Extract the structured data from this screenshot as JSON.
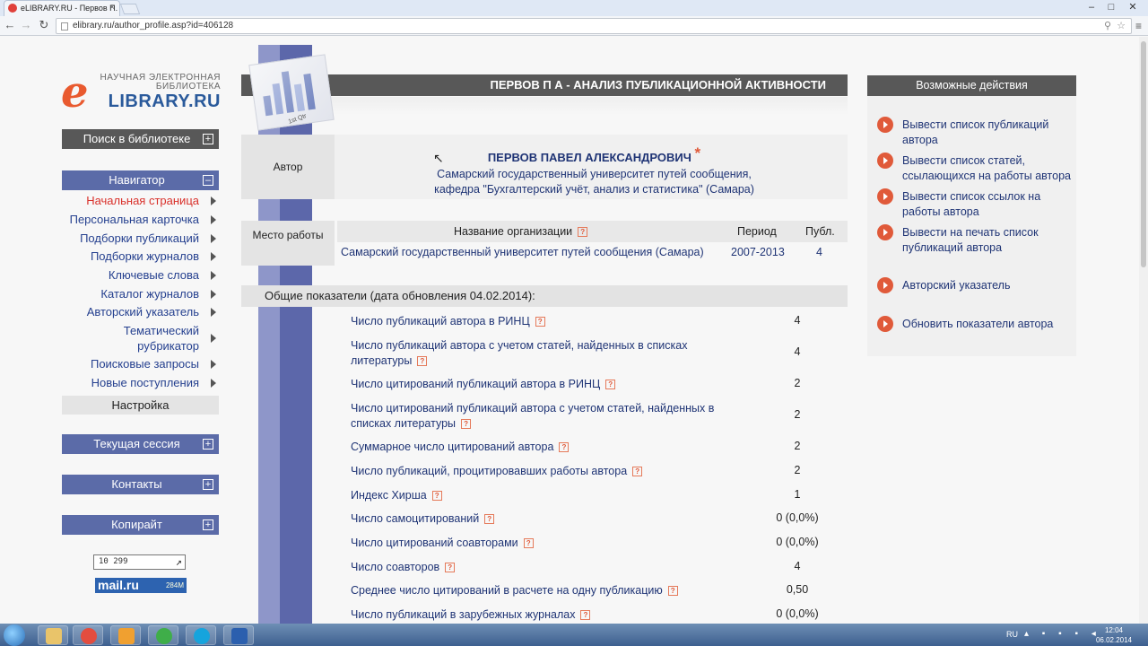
{
  "browser": {
    "tab_title": "eLIBRARY.RU - Первов П.",
    "url": "elibrary.ru/author_profile.asp?id=406128"
  },
  "logo": {
    "letter": "e",
    "line1": "НАУЧНАЯ ЭЛЕКТРОННАЯ",
    "line2": "БИБЛИОТЕКА",
    "line3": "LIBRARY.RU"
  },
  "sidebar": {
    "search": "Поиск в библиотеке",
    "navigator": "Навигатор",
    "items": [
      "Начальная страница",
      "Персональная карточка",
      "Подборки публикаций",
      "Подборки журналов",
      "Ключевые слова",
      "Каталог журналов",
      "Авторский указатель",
      "Тематический рубрикатор",
      "Поисковые запросы",
      "Новые поступления"
    ],
    "settings": "Настройка",
    "session": "Текущая сессия",
    "contacts": "Контакты",
    "copyright": "Копирайт",
    "counter": "10 299",
    "mailru": "mail.ru",
    "mailru_count": "284M"
  },
  "main": {
    "header": "ПЕРВОВ П А - АНАЛИЗ ПУБЛИКАЦИОННОЙ АКТИВНОСТИ",
    "chart_label": "1st Qtr",
    "author_label": "Автор",
    "author_name": "ПЕРВОВ ПАВЕЛ АЛЕКСАНДРОВИЧ",
    "author_star": "*",
    "author_aff1": "Самарский государственный университет путей сообщения,",
    "author_aff2": "кафедра \"Бухгалтерский учёт, анализ и статистика\" (Самара)",
    "work_label": "Место работы",
    "work_headers": {
      "org": "Название организации",
      "period": "Период",
      "pubs": "Публ."
    },
    "work_row": {
      "org": "Самарский государственный университет путей сообщения (Самара)",
      "period": "2007-2013",
      "pubs": "4"
    },
    "summary_title": "Общие показатели (дата обновления 04.02.2014):",
    "stats": [
      {
        "label": "Число публикаций автора в РИНЦ",
        "value": "4"
      },
      {
        "label": "Число публикаций автора с учетом статей, найденных в списках литературы",
        "value": "4"
      },
      {
        "label": "Число цитирований публикаций автора в РИНЦ",
        "value": "2"
      },
      {
        "label": "Число цитирований публикаций автора с учетом статей, найденных в списках литературы",
        "value": "2"
      },
      {
        "label": "Суммарное число цитирований автора",
        "value": "2"
      },
      {
        "label": "Число публикаций, процитировавших работы автора",
        "value": "2"
      },
      {
        "label": "Индекс Хирша",
        "value": "1"
      },
      {
        "label": "Число самоцитирований",
        "value": "0 (0,0%)"
      },
      {
        "label": "Число цитирований соавторами",
        "value": "0 (0,0%)"
      },
      {
        "label": "Число соавторов",
        "value": "4"
      },
      {
        "label": "Среднее число цитирований в расчете на одну публикацию",
        "value": "0,50"
      },
      {
        "label": "Число публикаций в зарубежных журналах",
        "value": "0 (0,0%)"
      }
    ]
  },
  "actions": {
    "title": "Возможные действия",
    "items": [
      "Вывести список публикаций автора",
      "Вывести список статей, ссылающихся на работы автора",
      "Вывести список ссылок на работы автора",
      "Вывести на печать список публикаций автора",
      "Авторский указатель",
      "Обновить показатели автора"
    ]
  },
  "taskbar": {
    "lang": "RU",
    "time": "12:04",
    "date": "06.02.2014"
  },
  "colors": {
    "accent": "#e05a3a",
    "nav_blue": "#5b6ba8",
    "dark_bar": "#585858",
    "link": "#1f3475"
  }
}
